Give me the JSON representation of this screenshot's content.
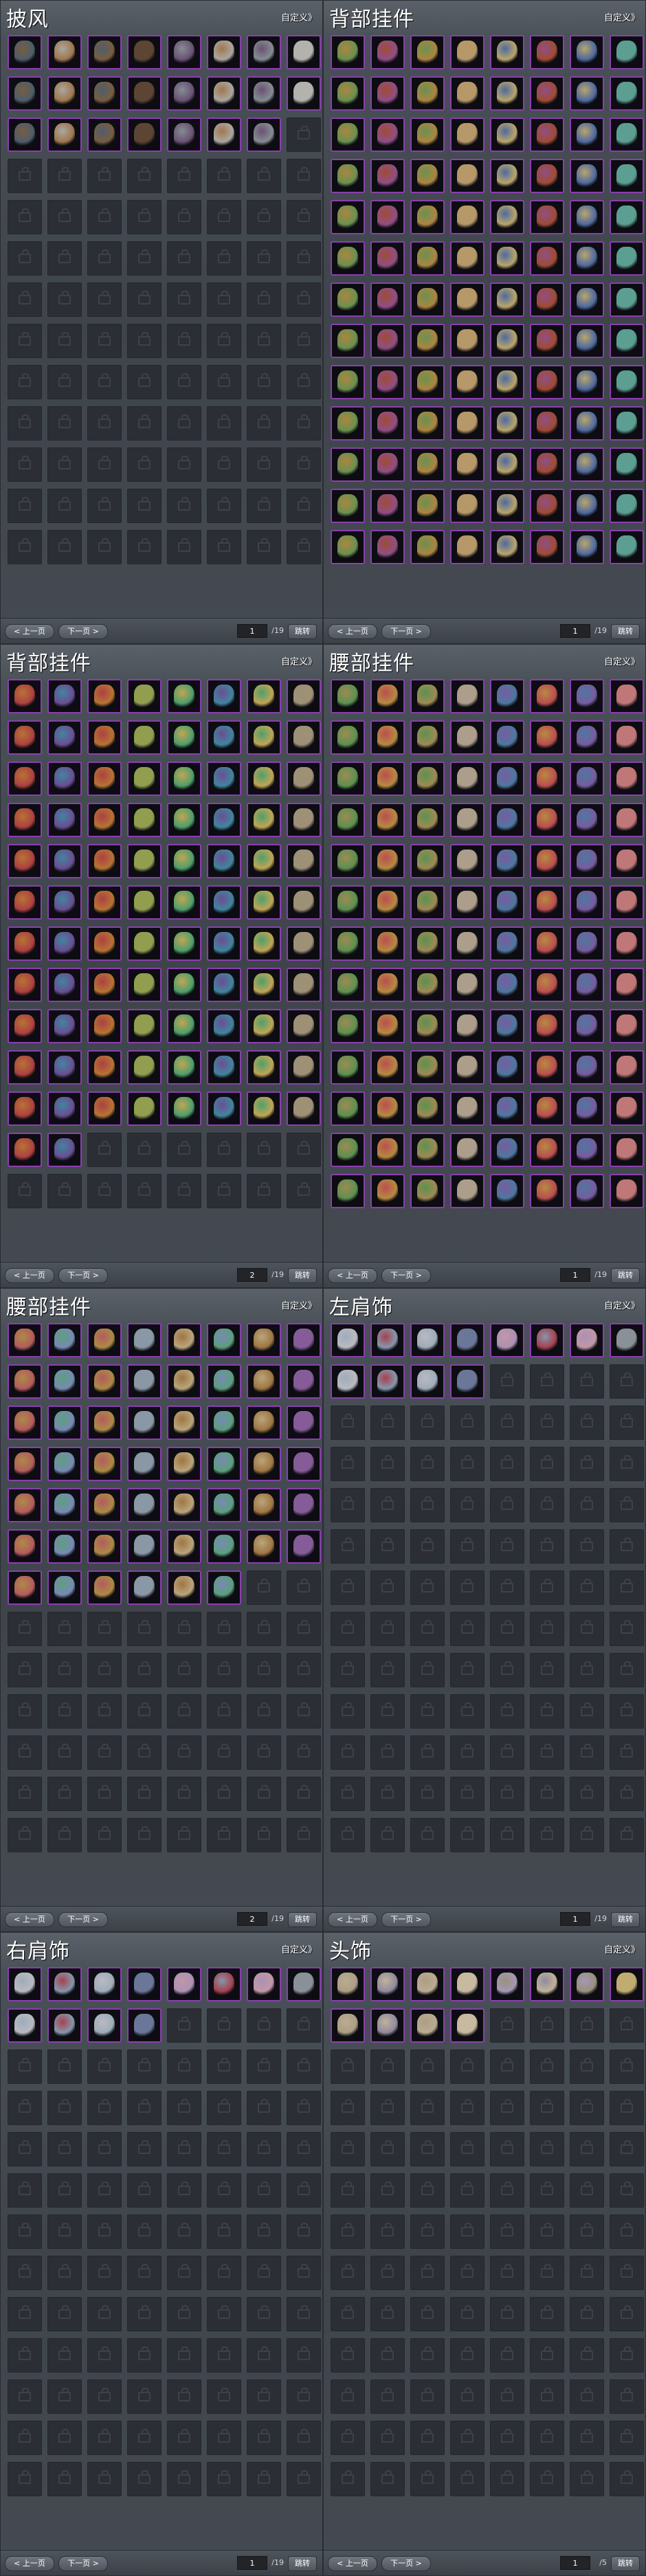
{
  "ui": {
    "customize_label": "自定义》",
    "prev_label": "< 上一页",
    "next_label": "下一页 >",
    "jump_label": "跳转"
  },
  "panels": [
    {
      "title": "披风",
      "filled": 23,
      "page": "1",
      "total": "/19",
      "colors": [
        "#8a6b4a",
        "#c7c2b8",
        "#5a6b7a",
        "#6b4f3a",
        "#9aa3a8",
        "#b88a5a",
        "#7a5e86",
        "#d0cfc8"
      ]
    },
    {
      "title": "背部挂件",
      "filled": 104,
      "page": "1",
      "total": "/19",
      "colors": [
        "#c89a4a",
        "#b8573a",
        "#7aa85a",
        "#d4b078",
        "#5a7ab8",
        "#a85a9a",
        "#d8c07a",
        "#6ab8a8"
      ]
    },
    {
      "title": "背部挂件",
      "filled": 90,
      "page": "2",
      "total": "/19",
      "colors": [
        "#d4863a",
        "#4a9ab8",
        "#c84a4a",
        "#a8b85a",
        "#e0c060",
        "#7a5aa8",
        "#5ab87a",
        "#b8a888"
      ]
    },
    {
      "title": "腰部挂件",
      "filled": 104,
      "page": "1",
      "total": "/19",
      "colors": [
        "#b8a060",
        "#d85a5a",
        "#6aa85a",
        "#c8b8a0",
        "#8a6ab8",
        "#d4a04a",
        "#5a8ab8",
        "#e08a8a"
      ]
    },
    {
      "title": "腰部挂件",
      "filled": 54,
      "page": "2",
      "total": "/19",
      "colors": [
        "#c8a050",
        "#6ab890",
        "#d06a6a",
        "#a0b0c0",
        "#b8884a",
        "#8aa0d0",
        "#d8c090",
        "#9a6ab0"
      ]
    },
    {
      "title": "左肩饰",
      "filled": 12,
      "page": "1",
      "total": "/19",
      "colors": [
        "#b8c8d8",
        "#c04a5a",
        "#d8d8e0",
        "#7a8ab0",
        "#e0b0c0",
        "#9ab0c8",
        "#c8a8d0",
        "#a0a8b0"
      ]
    },
    {
      "title": "右肩饰",
      "filled": 12,
      "page": "1",
      "total": "/19",
      "colors": [
        "#b8c8d8",
        "#c04a5a",
        "#d8d8e0",
        "#7a8ab0",
        "#e0b0c0",
        "#9ab0c8",
        "#c8a8d0",
        "#a0a8b0"
      ]
    },
    {
      "title": "头饰",
      "filled": 12,
      "page": "1",
      "total": "/5",
      "colors": [
        "#d8c8a8",
        "#e0d0b0",
        "#c8b898",
        "#e8d8b8",
        "#b0a890",
        "#a8a0b8",
        "#c0b0d0",
        "#e0c880"
      ]
    }
  ]
}
